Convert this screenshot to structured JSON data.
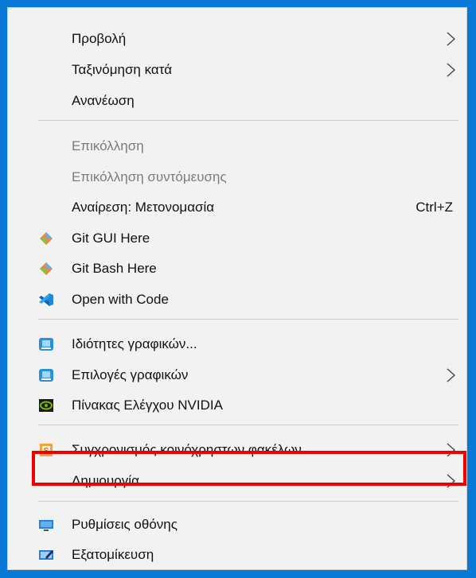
{
  "menu": {
    "items": {
      "view": {
        "label": "Προβολή",
        "icon": "none",
        "submenu": true
      },
      "sort": {
        "label": "Ταξινόμηση κατά",
        "icon": "none",
        "submenu": true
      },
      "refresh": {
        "label": "Ανανέωση",
        "icon": "none"
      },
      "paste": {
        "label": "Επικόλληση",
        "icon": "none",
        "disabled": true
      },
      "paste_shortcut": {
        "label": "Επικόλληση συντόμευσης",
        "icon": "none",
        "disabled": true
      },
      "undo": {
        "label": "Αναίρεση: Μετονομασία",
        "shortcut": "Ctrl+Z"
      },
      "git_gui": {
        "label": "Git GUI Here",
        "icon": "git-diamond-icon"
      },
      "git_bash": {
        "label": "Git Bash Here",
        "icon": "git-diamond-icon"
      },
      "open_code": {
        "label": "Open with Code",
        "icon": "vscode-icon"
      },
      "graphics_props": {
        "label": "Ιδιότητες γραφικών...",
        "icon": "intel-graphics-icon"
      },
      "graphics_options": {
        "label": "Επιλογές γραφικών",
        "icon": "intel-graphics-icon",
        "submenu": true
      },
      "nvidia": {
        "label": "Πίνακας Ελέγχου NVIDIA",
        "icon": "nvidia-icon"
      },
      "sync": {
        "label": "Συγχρονισμός κοινόχρηστων φακέλων",
        "icon": "sharepoint-s-icon",
        "submenu": true
      },
      "new": {
        "label": "Δημιουργία",
        "submenu": true,
        "highlighted": true
      },
      "display": {
        "label": "Ρυθμίσεις οθόνης",
        "icon": "monitor-icon"
      },
      "personalize": {
        "label": "Εξατομίκευση",
        "icon": "personalize-icon"
      }
    }
  },
  "colors": {
    "desktop": "#0a78d7",
    "menu_bg": "#f2f2f2",
    "highlight_border": "#ee0000",
    "disabled_text": "#7c7c7c"
  }
}
